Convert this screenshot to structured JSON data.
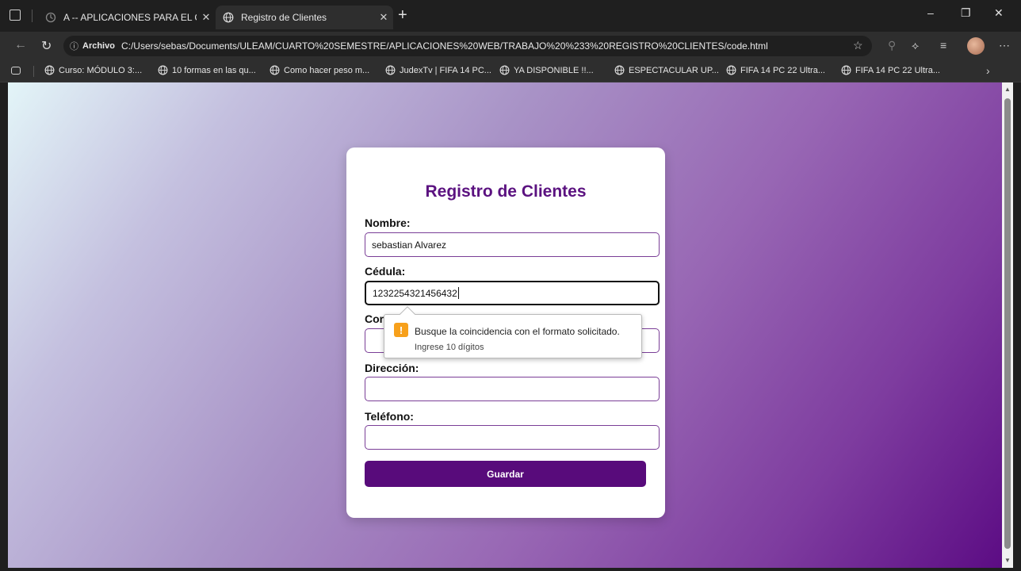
{
  "browser": {
    "tabs": [
      {
        "title": "A -- APLICACIONES PARA EL CLIE",
        "active": false
      },
      {
        "title": "Registro de Clientes",
        "active": true
      }
    ],
    "address": {
      "scheme_label": "Archivo",
      "url": "C:/Users/sebas/Documents/ULEAM/CUARTO%20SEMESTRE/APLICACIONES%20WEB/TRABAJO%20%233%20REGISTRO%20CLIENTES/code.html"
    },
    "bookmarks": [
      "Curso: MÓDULO 3:...",
      "10 formas en las qu...",
      "Como hacer peso m...",
      "JudexTv | FIFA 14 PC...",
      "YA DISPONIBLE !!...",
      "ESPECTACULAR UP...",
      "FIFA 14 PC 22 Ultra...",
      "FIFA 14 PC 22 Ultra..."
    ]
  },
  "form": {
    "title": "Registro de Clientes",
    "fields": [
      {
        "label": "Nombre:",
        "value": "sebastian Alvarez"
      },
      {
        "label": "Cédula:",
        "value": "1232254321456432"
      },
      {
        "label": "Correo:",
        "value": ""
      },
      {
        "label": "Dirección:",
        "value": ""
      },
      {
        "label": "Teléfono:",
        "value": ""
      }
    ],
    "submit_label": "Guardar"
  },
  "validation": {
    "icon": "!",
    "message": "Busque la coincidencia con el formato solicitado.",
    "hint": "Ingrese 10 dígitos"
  },
  "colors": {
    "accent": "#580b7b",
    "title": "#5b1280",
    "warning": "#f7a01b"
  }
}
